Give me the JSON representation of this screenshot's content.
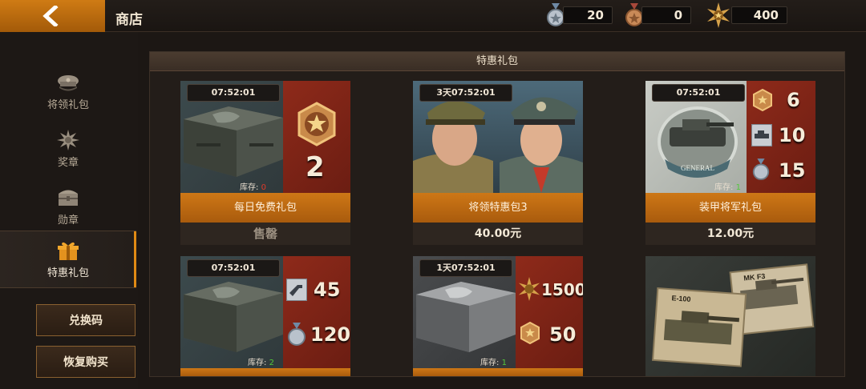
{
  "header": {
    "title": "商店",
    "currencies": [
      {
        "icon": "silver-medal-icon",
        "value": "20"
      },
      {
        "icon": "bronze-medal-icon",
        "value": "0"
      },
      {
        "icon": "gold-star-badge-icon",
        "value": "400"
      }
    ]
  },
  "sidebar": {
    "items": [
      {
        "label": "将领礼包",
        "icon": "officer-cap-icon"
      },
      {
        "label": "奖章",
        "icon": "medal-icon"
      },
      {
        "label": "勋章",
        "icon": "chest-icon"
      },
      {
        "label": "特惠礼包",
        "icon": "gift-icon"
      }
    ],
    "redeem_label": "兑换码",
    "restore_label": "恢复购买"
  },
  "panel": {
    "title": "特惠礼包",
    "stock_label": "库存:",
    "cards": [
      {
        "timer": "07:52:01",
        "name": "每日免费礼包",
        "price": "售罄",
        "stock": "0",
        "rewards": [
          {
            "icon": "star-medal-icon",
            "value": "2"
          }
        ]
      },
      {
        "timer": "3天07:52:01",
        "name": "将领特惠包3",
        "price": "40.00元"
      },
      {
        "timer": "07:52:01",
        "name": "装甲将军礼包",
        "price": "12.00元",
        "stock": "1",
        "badge_text": "GENERAL",
        "rewards": [
          {
            "icon": "star-medal-icon",
            "value": "6"
          },
          {
            "icon": "tank-card-icon",
            "value": "10"
          },
          {
            "icon": "silver-medal-icon",
            "value": "15"
          }
        ]
      },
      {
        "timer": "07:52:01",
        "stock": "2",
        "rewards": [
          {
            "icon": "gun-card-icon",
            "value": "45"
          },
          {
            "icon": "silver-medal-icon",
            "value": "120"
          }
        ]
      },
      {
        "timer": "1天07:52:01",
        "stock": "1",
        "rewards": [
          {
            "icon": "gold-star-badge-icon",
            "value": "1500"
          },
          {
            "icon": "star-medal-icon",
            "value": "50"
          }
        ]
      },
      {
        "tank_labels": [
          "MK F3",
          "E-100"
        ]
      }
    ]
  },
  "colors": {
    "accent": "#cd7716",
    "reward_bg": "#8e2a1a"
  }
}
